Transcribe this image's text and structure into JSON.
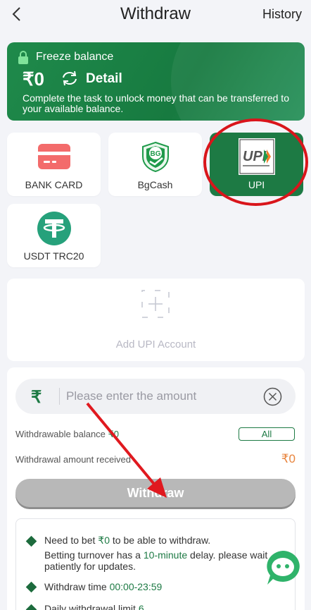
{
  "header": {
    "title": "Withdraw",
    "history_label": "History"
  },
  "freeze": {
    "label": "Freeze balance",
    "amount": "₹0",
    "detail_label": "Detail",
    "description": "Complete the task to unlock money that can be transferred to your available balance."
  },
  "methods": [
    {
      "label": "BANK CARD",
      "icon": "bank-card-icon",
      "selected": false
    },
    {
      "label": "BgCash",
      "icon": "bgcash-logo-icon",
      "selected": false
    },
    {
      "label": "UPI",
      "icon": "upi-logo-icon",
      "selected": true
    },
    {
      "label": "USDT TRC20",
      "icon": "usdt-icon",
      "selected": false
    }
  ],
  "add_account": {
    "label": "Add UPI Account"
  },
  "withdraw": {
    "currency_symbol": "₹",
    "amount_placeholder": "Please enter the amount",
    "balance_label": "Withdrawable balance ",
    "balance_value": "₹0",
    "all_label": "All",
    "received_label": "Withdrawal amount received",
    "received_value": "₹0",
    "button_label": "Withdraw"
  },
  "info": {
    "bet_prefix": "Need to bet ",
    "bet_value": "₹0",
    "bet_suffix": " to be able to withdraw.",
    "turnover_prefix": "Betting turnover has a ",
    "turnover_value": "10-minute",
    "turnover_suffix": " delay. please wait patiently for updates.",
    "time_prefix": "Withdraw time ",
    "time_value": "00:00-23:59",
    "limit_prefix": "Daily withdrawal limit ",
    "limit_value": "6"
  },
  "colors": {
    "brand_green": "#1d7a44",
    "highlight_red": "#d9151b",
    "amount_orange": "#e8843d"
  }
}
